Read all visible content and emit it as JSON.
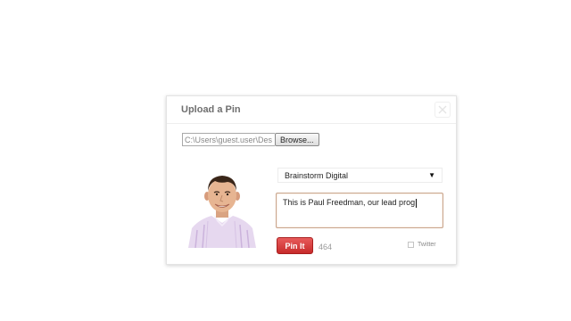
{
  "modal": {
    "title": "Upload a Pin",
    "close_icon": "close-icon"
  },
  "upload": {
    "file_path": "C:\\Users\\guest.user\\Des",
    "browse_label": "Browse..."
  },
  "preview": {
    "photo": "portrait-photo"
  },
  "board": {
    "selected": "Brainstorm Digital",
    "arrow_icon": "chevron-down-icon"
  },
  "description": {
    "value": "This is Paul Freedman, our lead prog"
  },
  "actions": {
    "pin_label": "Pin It",
    "char_count": "464",
    "twitter_label": "Twitter",
    "twitter_checked": false,
    "pin_color": "#d03535"
  }
}
